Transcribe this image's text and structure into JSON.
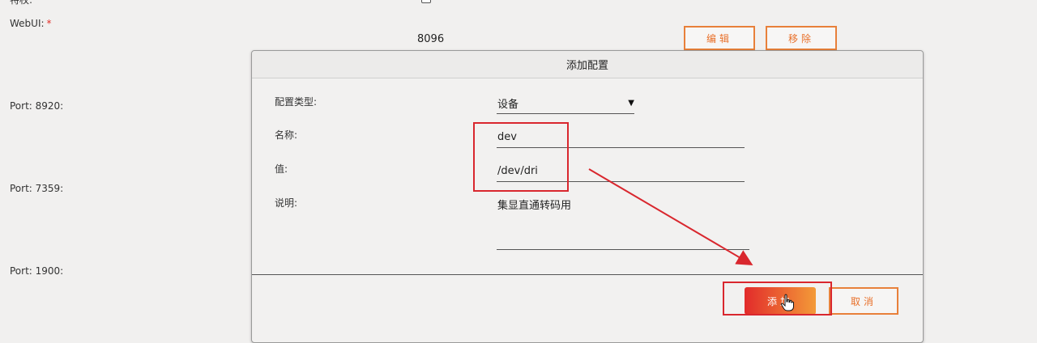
{
  "background": {
    "top_label": "特权:",
    "webui_label": "WebUI:",
    "required_mark": "*",
    "webui_value": "8096",
    "edit_button": "编辑",
    "remove_button": "移除",
    "port_labels": [
      "Port: 8920:",
      "Port: 7359:",
      "Port: 1900:"
    ]
  },
  "dialog": {
    "title": "添加配置",
    "fields": {
      "type_label": "配置类型:",
      "type_value": "设备",
      "name_label": "名称:",
      "name_value": "dev",
      "value_label": "值:",
      "value_value": "/dev/dri",
      "desc_label": "说明:",
      "desc_value": "集显直通转码用"
    },
    "add_button": "添加",
    "cancel_button": "取消"
  },
  "colors": {
    "accent": "#e8803a",
    "highlight": "#d9272e",
    "primary_gradient_start": "#e22b2b",
    "primary_gradient_end": "#f39a38"
  },
  "icons": {
    "select_arrow": "dropdown-arrow-icon",
    "cursor": "hand-pointer-icon",
    "annotation": "red-arrow-annotation"
  }
}
